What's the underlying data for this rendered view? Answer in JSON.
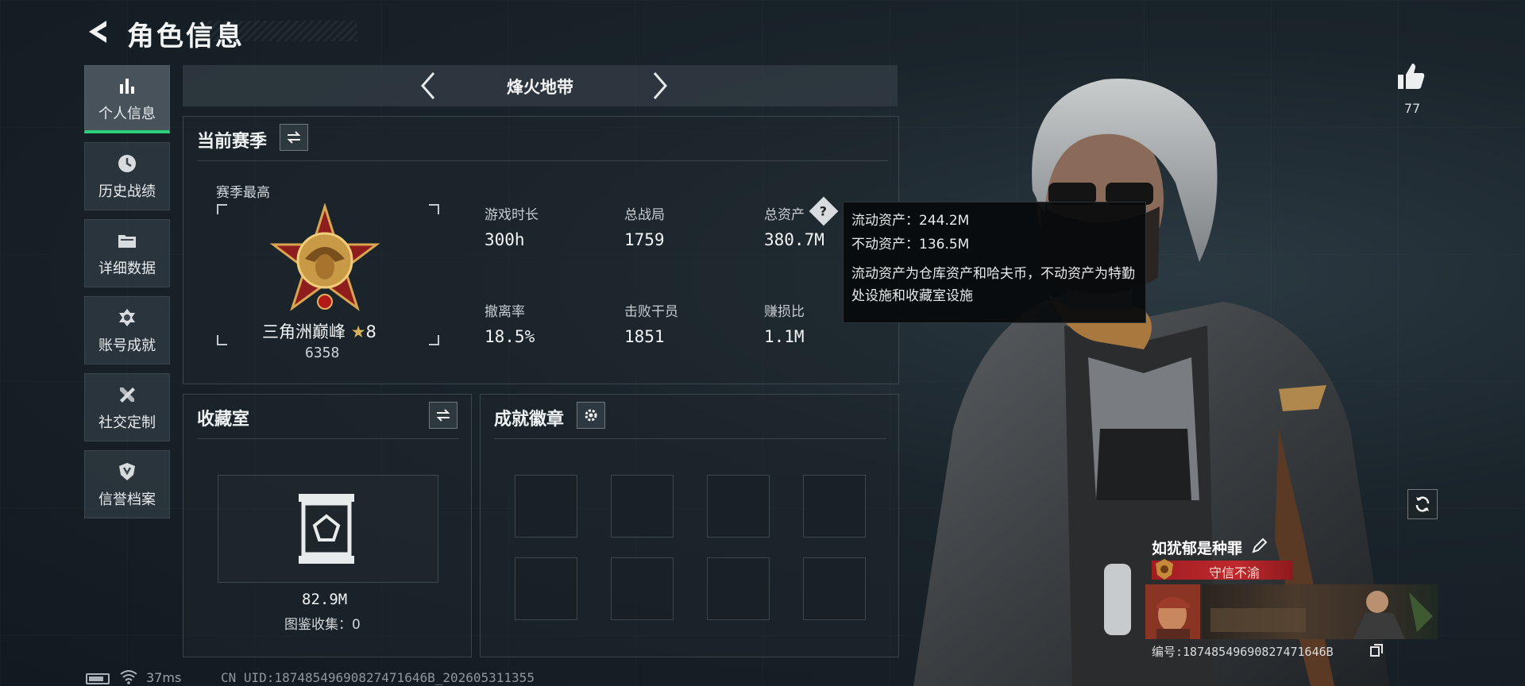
{
  "header": {
    "title": "角色信息"
  },
  "nav": {
    "items": [
      {
        "label": "个人信息",
        "icon": "bar-chart-icon",
        "active": true
      },
      {
        "label": "历史战绩",
        "icon": "history-clock-icon",
        "active": false
      },
      {
        "label": "详细数据",
        "icon": "folder-icon",
        "active": false
      },
      {
        "label": "账号成就",
        "icon": "achievement-badge-icon",
        "active": false
      },
      {
        "label": "社交定制",
        "icon": "tools-icon",
        "active": false
      },
      {
        "label": "信誉档案",
        "icon": "shield-icon",
        "active": false
      }
    ]
  },
  "map_selector": {
    "current": "烽火地带"
  },
  "season": {
    "title": "当前赛季",
    "best_label": "赛季最高",
    "rank_name": "三角洲巅峰",
    "rank_stars": "8",
    "rank_points": "6358",
    "stats": [
      {
        "label": "游戏时长",
        "value": "300h"
      },
      {
        "label": "总战局",
        "value": "1759"
      },
      {
        "label": "总资产",
        "value": "380.7M"
      },
      {
        "label": "撤离率",
        "value": "18.5%"
      },
      {
        "label": "击败干员",
        "value": "1851"
      },
      {
        "label": "赚损比",
        "value": "1.1M"
      }
    ]
  },
  "tooltip": {
    "liquid": "流动资产：244.2M",
    "fixed": "不动资产：136.5M",
    "description": "流动资产为仓库资产和哈夫币，不动资产为特勤处设施和收藏室设施"
  },
  "collection": {
    "title": "收藏室",
    "value": "82.9M",
    "catalog": "图鉴收集：0"
  },
  "achievements": {
    "title": "成就徽章",
    "slots": 8
  },
  "profile": {
    "likes": "77",
    "name": "如犹郁是种罪",
    "honor_title": "守信不渝",
    "uid": "编号:18748549690827471646B"
  },
  "status_bar": {
    "ping": "37ms",
    "uid": "CN UID:18748549690827471646B_202605311355"
  },
  "colors": {
    "accent": "#2bd17a",
    "badge_red": "#b4252a"
  }
}
